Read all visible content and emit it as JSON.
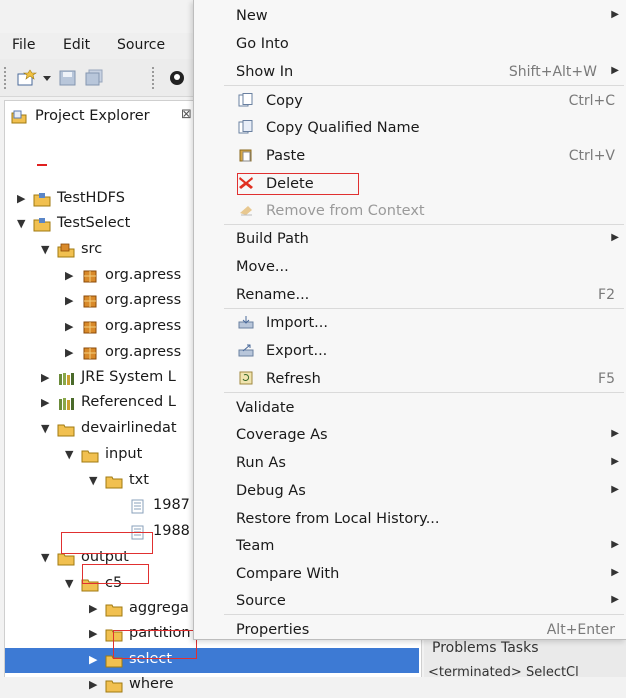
{
  "menubar": {
    "items": [
      "File",
      "Edit",
      "Source"
    ]
  },
  "explorer": {
    "title": "Project Explorer",
    "close_glyph": "⊠",
    "tree": [
      {
        "label": "TestHDFS",
        "expanded": false,
        "icon": "project-icon"
      },
      {
        "label": "TestSelect",
        "expanded": true,
        "icon": "project-icon"
      },
      {
        "label": "src",
        "expanded": true,
        "icon": "source-folder-icon"
      },
      {
        "label": "org.apress",
        "expanded": false,
        "icon": "package-icon"
      },
      {
        "label": "org.apress",
        "expanded": false,
        "icon": "package-icon"
      },
      {
        "label": "org.apress",
        "expanded": false,
        "icon": "package-icon"
      },
      {
        "label": "org.apress",
        "expanded": false,
        "icon": "package-icon"
      },
      {
        "label": "JRE System L",
        "expanded": false,
        "icon": "library-icon"
      },
      {
        "label": "Referenced L",
        "expanded": false,
        "icon": "library-icon"
      },
      {
        "label": "devairlinedat",
        "expanded": true,
        "icon": "folder-icon"
      },
      {
        "label": "input",
        "expanded": true,
        "icon": "folder-icon"
      },
      {
        "label": "txt",
        "expanded": true,
        "icon": "folder-icon"
      },
      {
        "label": "1987",
        "expanded": null,
        "icon": "file-icon"
      },
      {
        "label": "1988",
        "expanded": null,
        "icon": "file-icon"
      },
      {
        "label": "output",
        "expanded": true,
        "icon": "folder-icon"
      },
      {
        "label": "c5",
        "expanded": true,
        "icon": "folder-icon"
      },
      {
        "label": "aggrega",
        "expanded": false,
        "icon": "folder-icon"
      },
      {
        "label": "partition",
        "expanded": false,
        "icon": "folder-icon"
      },
      {
        "label": "select",
        "expanded": false,
        "icon": "folder-icon",
        "selected": true
      },
      {
        "label": "where",
        "expanded": false,
        "icon": "folder-icon"
      }
    ]
  },
  "bottom_panel": {
    "tabs": "Problems  Tasks",
    "console": "<terminated> SelectCl"
  },
  "context_menu": {
    "items": [
      {
        "label": "New",
        "submenu": true
      },
      {
        "label": "Go Into"
      },
      {
        "label": "Show In",
        "accel": "Shift+Alt+W",
        "submenu": true
      },
      {
        "label": "Copy",
        "accel": "Ctrl+C",
        "icon": "copy-icon"
      },
      {
        "label": "Copy Qualified Name",
        "icon": "copy-qualified-icon"
      },
      {
        "label": "Paste",
        "accel": "Ctrl+V",
        "icon": "paste-icon"
      },
      {
        "label": "Delete",
        "icon": "delete-icon"
      },
      {
        "label": "Remove from Context",
        "icon": "remove-context-icon",
        "disabled": true
      },
      {
        "label": "Build Path",
        "submenu": true
      },
      {
        "label": "Move..."
      },
      {
        "label": "Rename...",
        "accel": "F2"
      },
      {
        "label": "Import...",
        "icon": "import-icon"
      },
      {
        "label": "Export...",
        "icon": "export-icon"
      },
      {
        "label": "Refresh",
        "accel": "F5",
        "icon": "refresh-icon"
      },
      {
        "label": "Validate"
      },
      {
        "label": "Coverage As",
        "submenu": true
      },
      {
        "label": "Run As",
        "submenu": true
      },
      {
        "label": "Debug As",
        "submenu": true
      },
      {
        "label": "Restore from Local History..."
      },
      {
        "label": "Team",
        "submenu": true
      },
      {
        "label": "Compare With",
        "submenu": true
      },
      {
        "label": "Source",
        "submenu": true
      },
      {
        "label": "Properties",
        "accel": "Alt+Enter"
      }
    ]
  },
  "colors": {
    "selection": "#3d7ad4",
    "highlight": "#e03030"
  }
}
